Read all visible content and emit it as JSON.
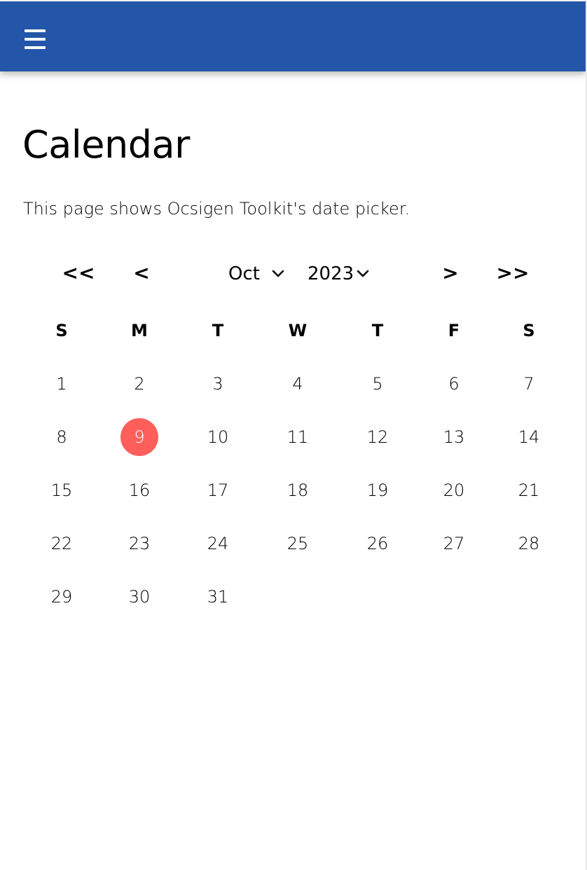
{
  "topbar": {
    "color": "#2356a8",
    "menu_icon": "hamburger-menu-icon"
  },
  "page": {
    "title": "Calendar",
    "description": "This page shows Ocsigen Toolkit's date picker."
  },
  "datepicker": {
    "prev_year_label": "<<",
    "prev_month_label": "<",
    "next_month_label": ">",
    "next_year_label": ">>",
    "month_select_value": "Oct",
    "year_select_value": "2023",
    "weekdays": [
      "S",
      "M",
      "T",
      "W",
      "T",
      "F",
      "S"
    ],
    "weeks": [
      [
        "1",
        "2",
        "3",
        "4",
        "5",
        "6",
        "7"
      ],
      [
        "8",
        "9",
        "10",
        "11",
        "12",
        "13",
        "14"
      ],
      [
        "15",
        "16",
        "17",
        "18",
        "19",
        "20",
        "21"
      ],
      [
        "22",
        "23",
        "24",
        "25",
        "26",
        "27",
        "28"
      ],
      [
        "29",
        "30",
        "31"
      ]
    ],
    "selected_day": "9",
    "selected_color": "#ff5f5b"
  }
}
